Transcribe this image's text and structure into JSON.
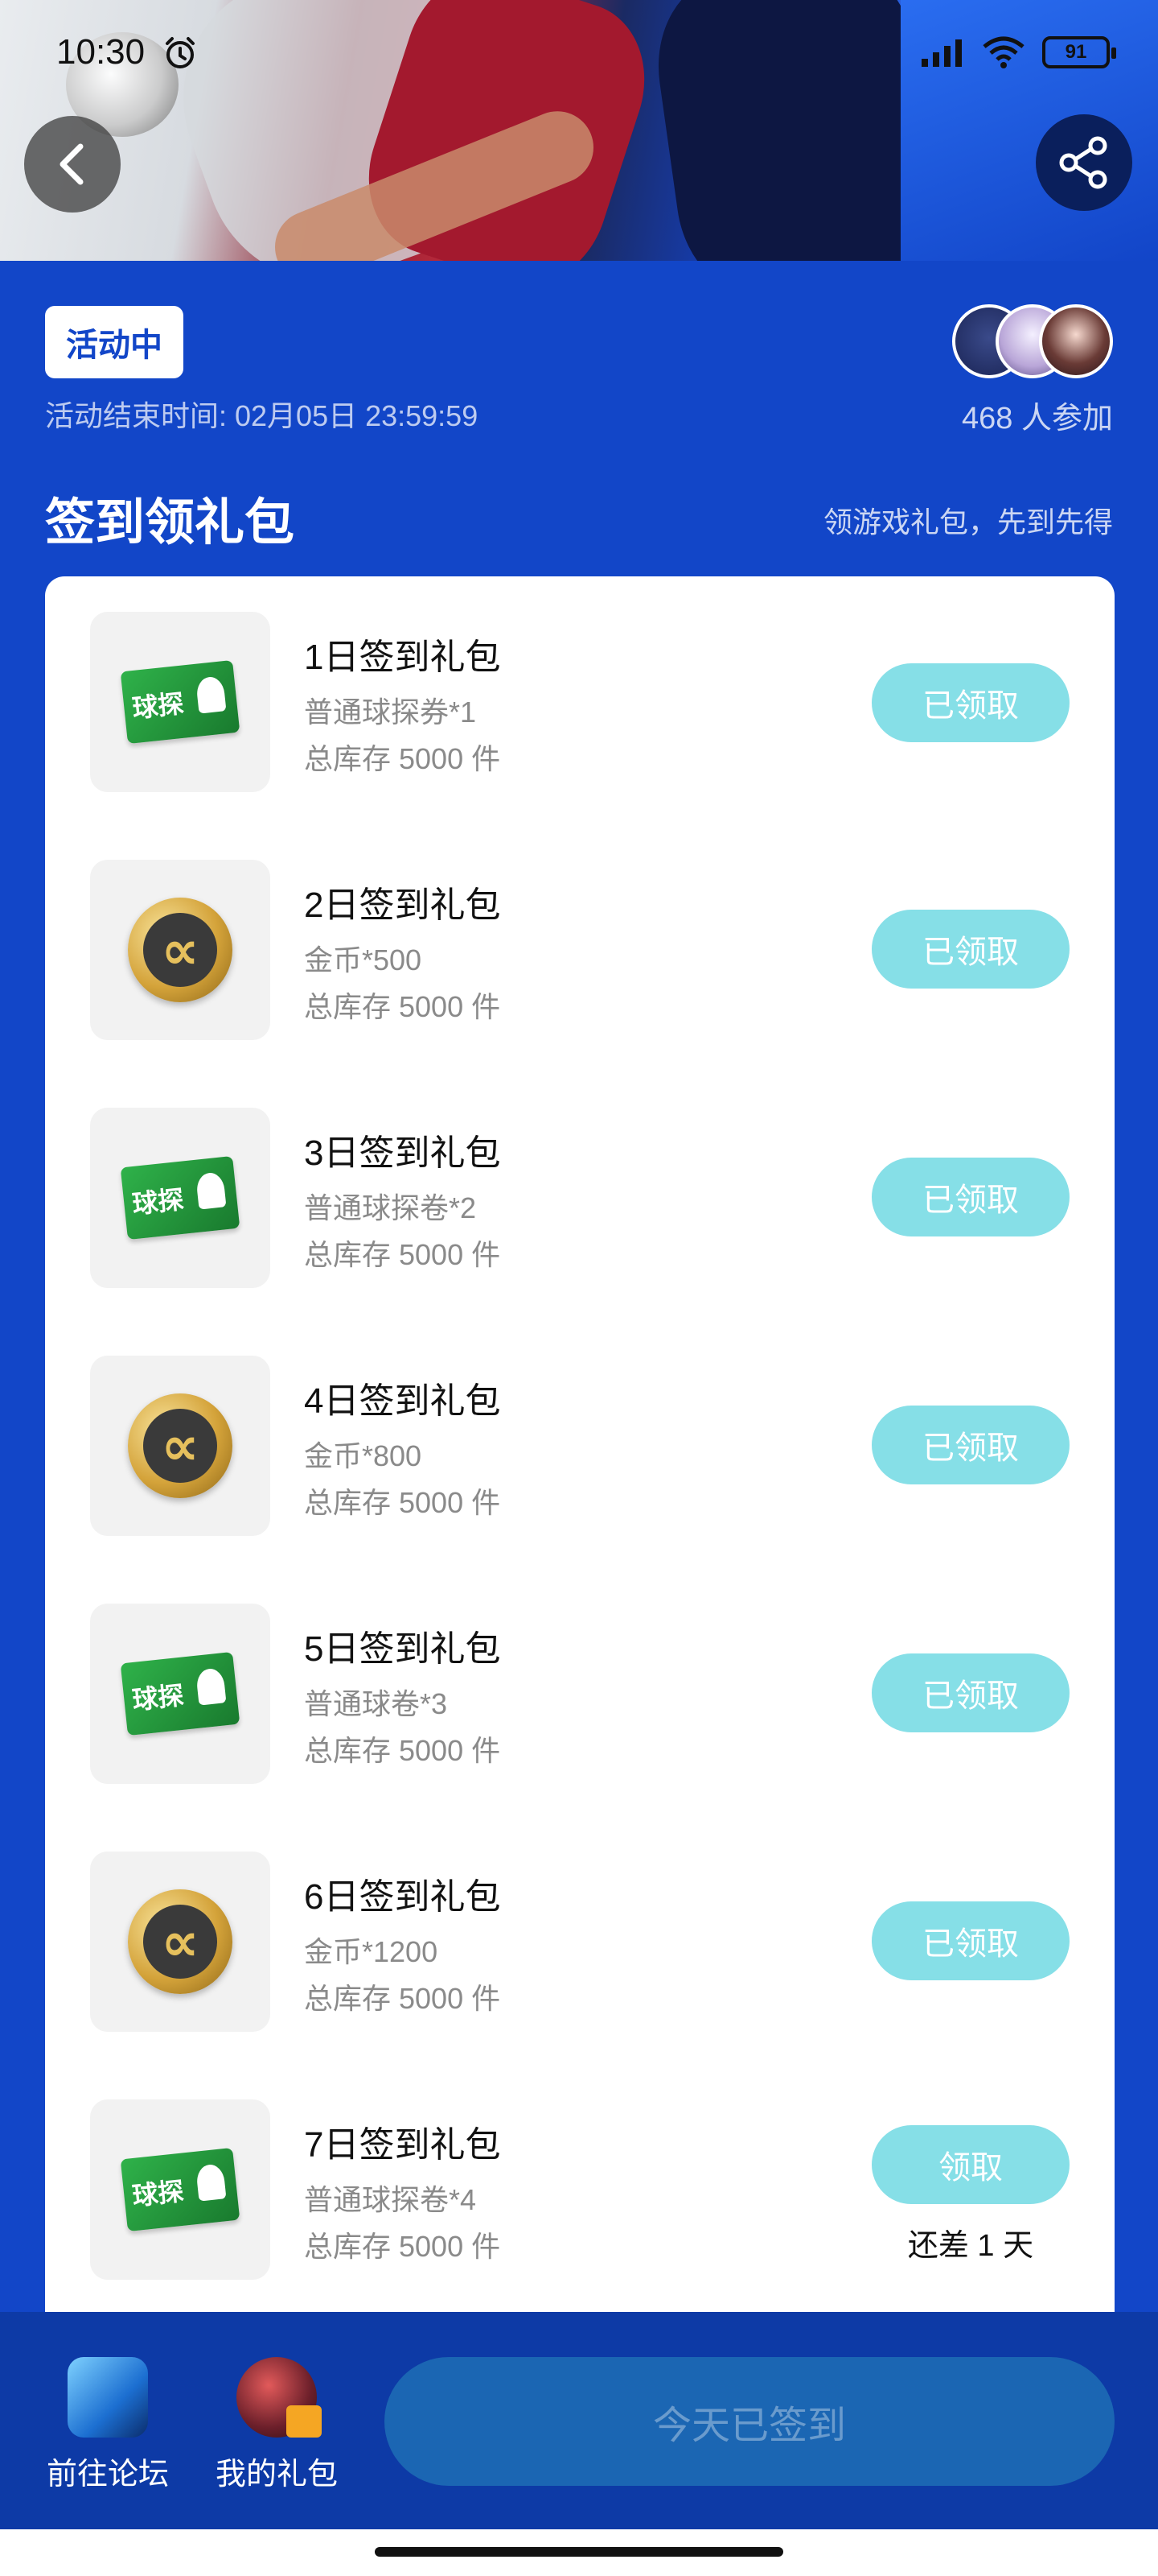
{
  "status_bar": {
    "time": "10:30",
    "battery": "91"
  },
  "activity": {
    "status_badge": "活动中",
    "end_time": "活动结束时间: 02月05日 23:59:59",
    "participants": "468 人参加"
  },
  "section": {
    "title": "签到领礼包",
    "subtitle": "领游戏礼包，先到先得"
  },
  "gifts": [
    {
      "title": "1日签到礼包",
      "desc": "普通球探券*1",
      "stock": "总库存 5000 件",
      "button": "已领取",
      "icon": "scout-ticket-icon"
    },
    {
      "title": "2日签到礼包",
      "desc": "金币*500",
      "stock": "总库存 5000 件",
      "button": "已领取",
      "icon": "gold-coin-icon"
    },
    {
      "title": "3日签到礼包",
      "desc": "普通球探卷*2",
      "stock": "总库存 5000 件",
      "button": "已领取",
      "icon": "scout-ticket-icon"
    },
    {
      "title": "4日签到礼包",
      "desc": "金币*800",
      "stock": "总库存 5000 件",
      "button": "已领取",
      "icon": "gold-coin-icon"
    },
    {
      "title": "5日签到礼包",
      "desc": "普通球卷*3",
      "stock": "总库存 5000 件",
      "button": "已领取",
      "icon": "scout-ticket-icon"
    },
    {
      "title": "6日签到礼包",
      "desc": "金币*1200",
      "stock": "总库存 5000 件",
      "button": "已领取",
      "icon": "gold-coin-icon"
    },
    {
      "title": "7日签到礼包",
      "desc": "普通球探卷*4",
      "stock": "总库存 5000 件",
      "button": "领取",
      "remaining": "还差 1 天",
      "icon": "scout-ticket-icon"
    }
  ],
  "ticket_text": "球探",
  "coin_symbol": "∝",
  "bottom_bar": {
    "forum_label": "前往论坛",
    "gifts_label": "我的礼包",
    "signed_button": "今天已签到"
  },
  "colors": {
    "primary": "#1246c8",
    "button": "#86dfe7",
    "signed_button": "#1b66b3"
  }
}
